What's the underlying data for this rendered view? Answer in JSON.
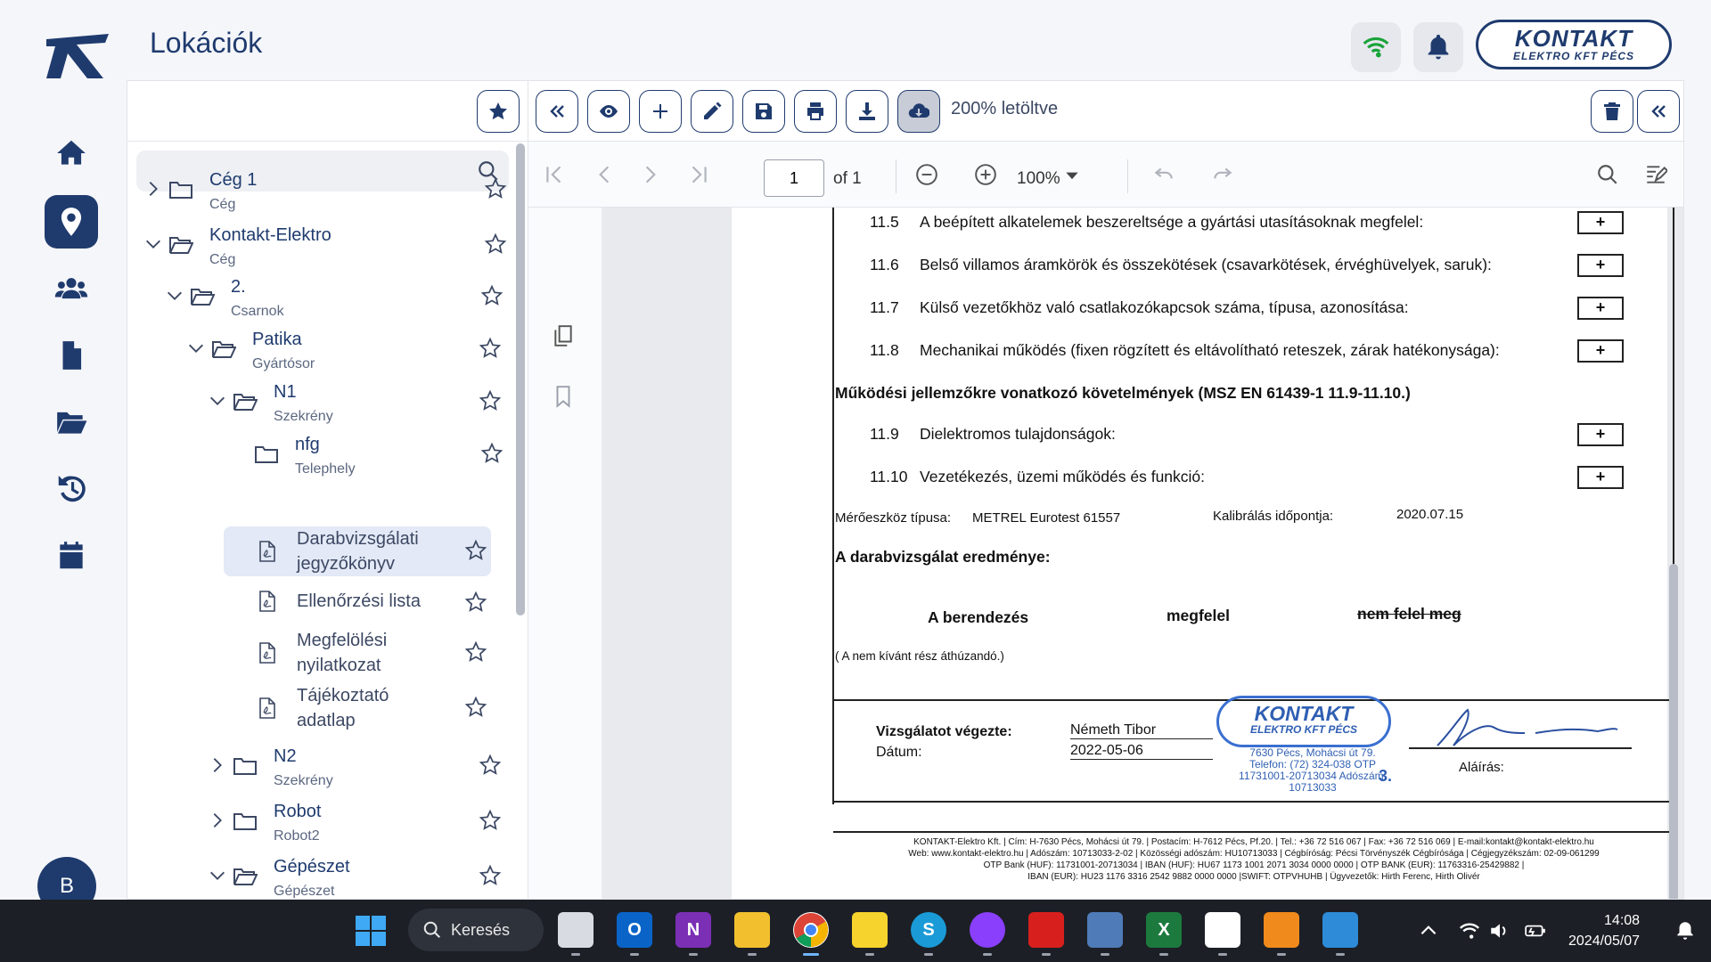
{
  "app": {
    "page_title": "Lokációk",
    "brand_name": "KONTAKT",
    "brand_sub": "ELEKTRO KFT PÉCS",
    "user_initial": "B"
  },
  "nav": {
    "items": [
      {
        "name": "home-icon",
        "active": false
      },
      {
        "name": "location-pin-icon",
        "active": true
      },
      {
        "name": "users-icon",
        "active": false
      },
      {
        "name": "document-icon",
        "active": false
      },
      {
        "name": "folder-open-icon",
        "active": false
      },
      {
        "name": "history-icon",
        "active": false
      },
      {
        "name": "calendar-icon",
        "active": false
      }
    ]
  },
  "header": {
    "wifi_icon": "wifi-icon",
    "bell_icon": "bell-icon",
    "accent_color": "#1f3b6e",
    "wifi_color": "#1aa33a"
  },
  "tree": {
    "search_placeholder": "",
    "nodes": [
      {
        "title": "Cég 1",
        "sub": "Cég",
        "expanded": false
      },
      {
        "title": "Kontakt-Elektro",
        "sub": "Cég",
        "expanded": true
      },
      {
        "title": "2.",
        "sub": "Csarnok",
        "expanded": true
      },
      {
        "title": "Patika",
        "sub": "Gyártósor",
        "expanded": true
      },
      {
        "title": "N1",
        "sub": "Szekrény",
        "expanded": true
      },
      {
        "title": "nfg",
        "sub": "Telephely",
        "expanded": false
      },
      {
        "title": "N2",
        "sub": "Szekrény",
        "expanded": false
      },
      {
        "title": "Robot",
        "sub": "Robot2",
        "expanded": false
      },
      {
        "title": "Gépészet",
        "sub": "Gépészet",
        "expanded": true
      }
    ],
    "documents": [
      {
        "line1": "Darabvizsgálati",
        "line2": "jegyzőkönyv",
        "selected": true
      },
      {
        "line1": "Ellenőrzési lista",
        "line2": "",
        "selected": false
      },
      {
        "line1": "Megfelölési",
        "line2": "nyilatkozat",
        "selected": false
      },
      {
        "line1": "Tájékoztató",
        "line2": "adatlap",
        "selected": false
      }
    ]
  },
  "viewer": {
    "download_status": "200% letöltve",
    "page_current": "1",
    "page_total_label": "of 1",
    "zoom": "100%"
  },
  "pdf": {
    "rows_a": [
      {
        "num": "11.5",
        "text": "A beépített alkatelemek beszereltsége a gyártási utasításoknak megfelel:",
        "result": "+"
      },
      {
        "num": "11.6",
        "text": "Belső villamos áramkörök és összekötések (csavarkötések, érvéghüvelyek, saruk):",
        "result": "+"
      },
      {
        "num": "11.7",
        "text": "Külső vezetőkhöz való csatlakozókapcsok száma, típusa, azonosítása:",
        "result": "+"
      },
      {
        "num": "11.8",
        "text": "Mechanikai működés (fixen rögzített és eltávolítható reteszek, zárak hatékonysága):",
        "result": "+"
      }
    ],
    "section_title": "Működési jellemzőkre vonatkozó követelmények (MSZ EN 61439-1 11.9-11.10.)",
    "rows_b": [
      {
        "num": "11.9",
        "text": "Dielektromos tulajdonságok:",
        "result": "+"
      },
      {
        "num": "11.10",
        "text": "Vezetékezés, üzemi működés és funkció:",
        "result": "+"
      }
    ],
    "instrument_label": "Mérőeszköz típusa:",
    "instrument_value": "METREL Eurotest 61557",
    "calibration_label": "Kalibrálás időpontja:",
    "calibration_value": "2020.07.15",
    "result_title": "A darabvizsgálat eredménye:",
    "result_subject": "A berendezés",
    "result_ok": "megfelel",
    "result_nok": "nem felel meg",
    "result_note": "( A nem kívánt rész áthúzandó.)",
    "tested_by_label": "Vizsgálatot végezte:",
    "tested_by": "Németh Tibor",
    "date_label": "Dátum:",
    "date_value": "2022-05-06",
    "signature_label": "Aláírás:",
    "stamp": {
      "name": "KONTAKT",
      "sub": "ELEKTRO KFT PÉCS",
      "lines": "7630 Pécs, Mohácsi út 79. Telefon: (72) 324-038 OTP 11731001-20713034 Adószám: 10713033",
      "number": "3."
    },
    "footer_lines": [
      "KONTAKT-Elektro Kft. | Cím: H-7630 Pécs, Mohácsi út 79. | Postacím: H-7612 Pécs, Pf.20. | Tel.: +36 72 516 067 | Fax: +36 72 516 069 | E-mail:kontakt@kontakt-elektro.hu",
      "Web: www.kontakt-elektro.hu | Adószám: 10713033-2-02 | Közösségi adószám: HU10713033 | Cégbíróság: Pécsi Törvényszék Cégbírósága | Cégjegyzékszám: 02-09-061299",
      "OTP Bank (HUF): 11731001-20713034 | IBAN (HUF): HU67 1173 1001 2071 3034 0000 0000 | OTP BANK (EUR): 11763316-25429882 |",
      "IBAN (EUR): HU23 1176 3316 2542 9882 0000 0000 |SWIFT: OTPVHUHB | Ügyvezetők: Hirth Ferenc, Hirth Olivér"
    ]
  },
  "taskbar": {
    "search_label": "Keresés",
    "time": "14:08",
    "date": "2024/05/07"
  }
}
